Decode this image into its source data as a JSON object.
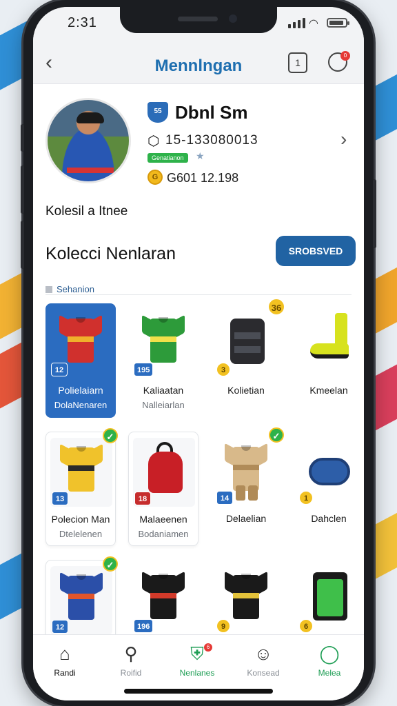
{
  "status_bar": {
    "time": "2:31"
  },
  "header": {
    "title": "Mennlngan",
    "back_icon": "chevron-left-icon",
    "calendar_label": "1",
    "notif_count": "0"
  },
  "profile": {
    "club_badge": "55",
    "name": "Dbnl Sm",
    "id": "15-133080013",
    "tag": "Genatianon",
    "balance": "G601 12.198",
    "collection_note": "Kolesil a Itnee"
  },
  "section": {
    "title": "Kolecci Nenlaran",
    "saved_button": "SROBSVED",
    "filter_label": "Sehanion"
  },
  "items": [
    {
      "name": "Polielaiarn",
      "sub": "DolaNenaren",
      "badge": "12",
      "badge_style": "blue",
      "corner": "",
      "colors": [
        "#d0302d",
        "#f0b02b"
      ],
      "type": "shirt",
      "selected": true,
      "boxed": false
    },
    {
      "name": "Kaliaatan",
      "sub": "Nalleiarlan",
      "badge": "195",
      "badge_style": "blue",
      "corner": "",
      "colors": [
        "#2d9b3a",
        "#f1e04a"
      ],
      "type": "shirt",
      "selected": false,
      "boxed": false
    },
    {
      "name": "Kolietian",
      "sub": "",
      "badge": "3",
      "badge_style": "yellow",
      "corner": "36",
      "corner_style": "yellow",
      "colors": [
        "#2b2b2f",
        "#4a4d55"
      ],
      "type": "vest",
      "selected": false,
      "boxed": false
    },
    {
      "name": "Kmeelan",
      "sub": "",
      "badge": "",
      "badge_style": "",
      "corner": "",
      "colors": [
        "#d7e21e",
        "#1a1a1a"
      ],
      "type": "boot",
      "selected": false,
      "boxed": false
    },
    {
      "name": "Polecion Man",
      "sub": "Dtelelenen",
      "badge": "13",
      "badge_style": "blue",
      "corner": "✓",
      "corner_style": "green",
      "colors": [
        "#f0c22b",
        "#2a2a2a"
      ],
      "type": "shirt",
      "selected": false,
      "boxed": true
    },
    {
      "name": "Malaeenen",
      "sub": "Bodaniamen",
      "badge": "18",
      "badge_style": "red",
      "corner": "",
      "colors": [
        "#c81f26",
        "#1a1a1a"
      ],
      "type": "bag",
      "selected": false,
      "boxed": true
    },
    {
      "name": "Delaelian",
      "sub": "",
      "badge": "14",
      "badge_style": "blue",
      "corner": "✓",
      "corner_style": "green",
      "colors": [
        "#d8b98a",
        "#b08b58"
      ],
      "type": "kit",
      "selected": false,
      "boxed": false
    },
    {
      "name": "Dahclen",
      "sub": "",
      "badge": "1",
      "badge_style": "yellow",
      "corner": "",
      "colors": [
        "#2d5ea8",
        "#1f3f76"
      ],
      "type": "roll",
      "selected": false,
      "boxed": false
    },
    {
      "name": "",
      "sub": "",
      "badge": "12",
      "badge_style": "blue",
      "corner": "✓",
      "corner_style": "green",
      "colors": [
        "#2b4fa8",
        "#e0552b"
      ],
      "type": "shirt",
      "selected": false,
      "boxed": true
    },
    {
      "name": "",
      "sub": "",
      "badge": "196",
      "badge_style": "blue",
      "corner": "",
      "colors": [
        "#1a1a1a",
        "#d23a2a"
      ],
      "type": "shirt",
      "selected": false,
      "boxed": false
    },
    {
      "name": "",
      "sub": "",
      "badge": "9",
      "badge_style": "yellow",
      "corner": "",
      "colors": [
        "#1a1a1a",
        "#e3c23a"
      ],
      "type": "shirt",
      "selected": false,
      "boxed": false
    },
    {
      "name": "",
      "sub": "",
      "badge": "6",
      "badge_style": "yellow",
      "corner": "",
      "colors": [
        "#3fbf4a",
        "#1a1a1a"
      ],
      "type": "bib",
      "selected": false,
      "boxed": false
    }
  ],
  "tabbar": {
    "tabs": [
      {
        "label": "Randi",
        "icon": "home-icon"
      },
      {
        "label": "Roifid",
        "icon": "search-icon"
      },
      {
        "label": "Nenlanes",
        "icon": "shield-icon",
        "badge": "6"
      },
      {
        "label": "Konsead",
        "icon": "user-icon"
      },
      {
        "label": "Melea",
        "icon": "chat-icon"
      }
    ]
  }
}
